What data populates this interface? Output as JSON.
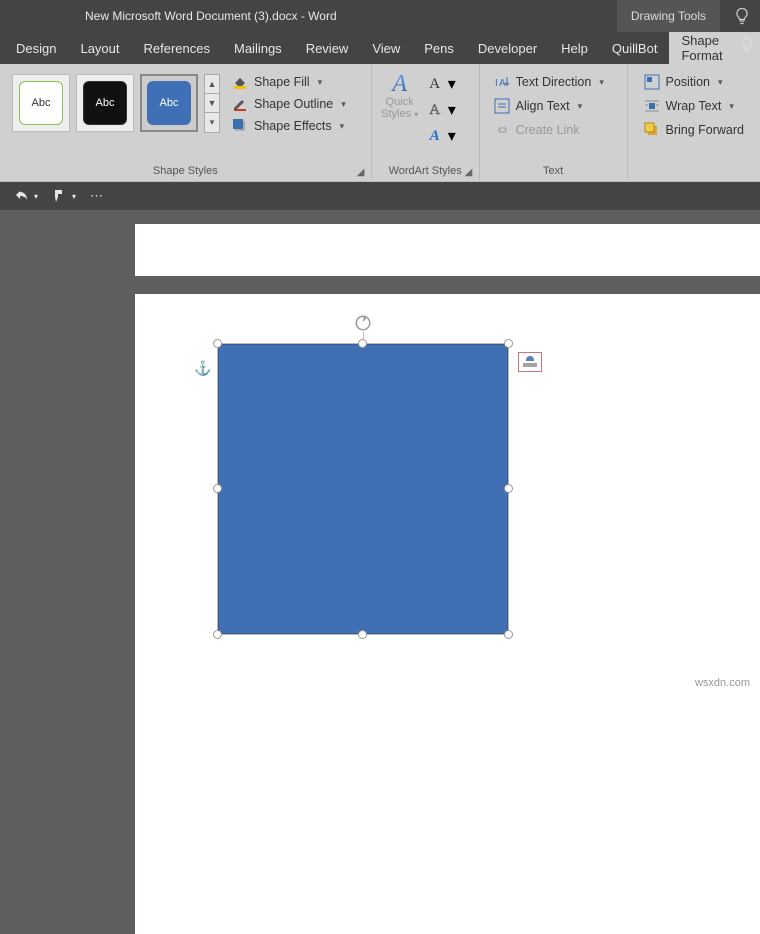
{
  "title": "New Microsoft Word Document (3).docx  -  Word",
  "toolTab": "Drawing Tools",
  "tabs": [
    "Design",
    "Layout",
    "References",
    "Mailings",
    "Review",
    "View",
    "Pens",
    "Developer",
    "Help",
    "QuillBot",
    "Shape Format"
  ],
  "activeTab": "Shape Format",
  "gallery": {
    "thumbLabel": "Abc"
  },
  "shapeCmds": {
    "fill": "Shape Fill",
    "outline": "Shape Outline",
    "effects": "Shape Effects"
  },
  "groups": {
    "shapeStyles": "Shape Styles",
    "wordArt": "WordArt Styles",
    "text": "Text"
  },
  "wordArt": {
    "quick": "Quick",
    "styles": "Styles"
  },
  "textCmds": {
    "direction": "Text Direction",
    "align": "Align Text",
    "link": "Create Link"
  },
  "arrange": {
    "position": "Position",
    "wrap": "Wrap Text",
    "forward": "Bring Forward"
  },
  "watermark": "wsxdn.com"
}
